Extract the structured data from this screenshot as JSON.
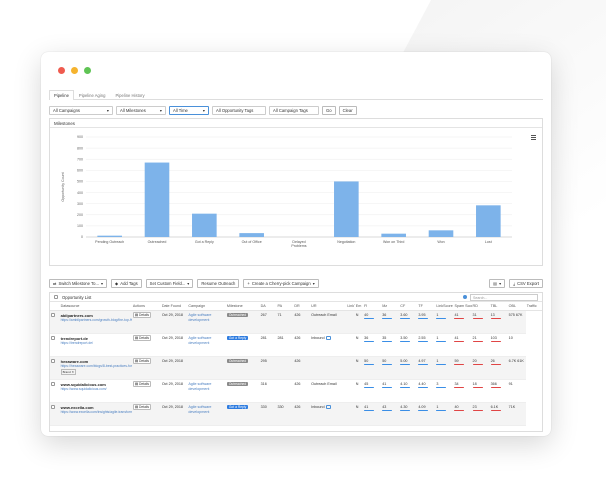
{
  "colors": {
    "dot_red": "#ef5b4f",
    "dot_yellow": "#f5b32e",
    "dot_green": "#5fc454",
    "bar": "#7db3ea",
    "accent": "#4a90d9"
  },
  "tabs": [
    {
      "label": "Pipeline",
      "active": true
    },
    {
      "label": "Pipeline Aging",
      "active": false
    },
    {
      "label": "Pipeline History",
      "active": false
    }
  ],
  "filters": {
    "campaigns": "All Campaigns",
    "milestones": "All Milestones",
    "time": "All Time",
    "opportunity_tags": "All Opportunity Tags",
    "campaign_tags": "All Campaign Tags",
    "go": "Go",
    "clear": "Clear"
  },
  "panel_title": "Milestones",
  "chart_data": {
    "type": "bar",
    "title": "",
    "xlabel": "",
    "ylabel": "Opportunity Count",
    "ylim": [
      0,
      900
    ],
    "yticks": [
      0,
      100,
      200,
      300,
      400,
      500,
      600,
      700,
      800,
      900
    ],
    "categories": [
      "Pending Outreach",
      "Outreached",
      "Got a Reply",
      "Out of Office",
      "Delayed Problems",
      "Negotiation",
      "Won on Third",
      "Won",
      "Lost"
    ],
    "category_labels": [
      [
        "Pending Outreach"
      ],
      [
        "Outreached"
      ],
      [
        "Got a Reply"
      ],
      [
        "Out of Office"
      ],
      [
        "Delayed",
        "Problems"
      ],
      [
        "Negotiation"
      ],
      [
        "Won on Third"
      ],
      [
        "Won"
      ],
      [
        "Lost"
      ]
    ],
    "values": [
      12,
      670,
      210,
      35,
      0,
      500,
      30,
      60,
      285
    ]
  },
  "toolbar": {
    "switch_milestone": "Switch Milestone To...",
    "add_tags": "Add Tags",
    "set_custom_field": "Set Custom Field...",
    "resume_outreach": "Resume Outreach",
    "create_campaign": "Create a Cherry-pick Campaign",
    "csv_export": "CSV Export"
  },
  "list": {
    "title": "Opportunity List",
    "search_placeholder": "Search...",
    "columns": [
      "Datasource",
      "Actions",
      "Date Found",
      "Campaign",
      "Milestone",
      "DA",
      "PA",
      "DR",
      "UR",
      "LinkType",
      "Em",
      "Fl",
      "Mz",
      "CF",
      "TF",
      "LinkScore",
      "Spam Score",
      "RD",
      "TBL",
      "OBL",
      "Traffic"
    ],
    "rows": [
      {
        "domain": "abilpartners.com",
        "url": "https://ambilpartners.com/growth-blog/the-top-five-agile-t...",
        "action": "Details",
        "date": "Oct 29, 2018",
        "campaign": "Agile software development",
        "status": "Outreached",
        "status_type": "out",
        "da": "267",
        "pa": "71",
        "dr": "426",
        "contact": "Outreach Email",
        "mail": false,
        "flag": "N",
        "m1": "40",
        "m2": "36",
        "m3": "3.60",
        "m4": "3.95",
        "spam": "1",
        "r1": "41",
        "r2": "31",
        "r3": "13",
        "traffic": "575",
        "traffic2": "67K",
        "tag": ""
      },
      {
        "domain": "trendreport.de",
        "url": "https://trendreport.de/",
        "action": "Details",
        "date": "Oct 29, 2018",
        "campaign": "Agile software development",
        "status": "Got a Reply",
        "status_type": "reply",
        "da": "281",
        "pa": "281",
        "dr": "426",
        "contact": "Inbound",
        "mail": true,
        "flag": "N",
        "m1": "36",
        "m2": "35",
        "m3": "3.50",
        "m4": "2.55",
        "spam": "1",
        "r1": "41",
        "r2": "21",
        "r3": "103",
        "traffic": "10",
        "traffic2": "",
        "tag": ""
      },
      {
        "domain": "hexaware.com",
        "url": "https://hexaware.com/blogs/8-best-practices-for-agile-s...",
        "action": "Details",
        "date": "Oct 29, 2018",
        "campaign": "",
        "status": "Outreached",
        "status_type": "out",
        "da": "295",
        "pa": "",
        "dr": "426",
        "contact": "",
        "mail": false,
        "flag": "N",
        "m1": "50",
        "m2": "50",
        "m3": "5.00",
        "m4": "4.97",
        "spam": "1",
        "r1": "59",
        "r2": "20",
        "r3": "26",
        "traffic": "6.7K",
        "traffic2": "61K",
        "tag": "Brand"
      },
      {
        "domain": "www.squidalicious.com",
        "url": "https://www.squidalicious.com/",
        "action": "Details",
        "date": "Oct 29, 2018",
        "campaign": "Agile software development",
        "status": "Outreached",
        "status_type": "out",
        "da": "316",
        "pa": "",
        "dr": "426",
        "contact": "Outreach Email",
        "mail": false,
        "flag": "N",
        "m1": "45",
        "m2": "41",
        "m3": "4.10",
        "m4": "4.40",
        "spam": "3",
        "r1": "34",
        "r2": "18",
        "r3": "366",
        "traffic": "91",
        "traffic2": "",
        "tag": ""
      },
      {
        "domain": "www.excella.com",
        "url": "https://www.excella.com/insights/agile-transformation-t...",
        "action": "Details",
        "date": "Oct 29, 2018",
        "campaign": "Agile software development",
        "status": "Got a Reply",
        "status_type": "reply",
        "da": "330",
        "pa": "330",
        "dr": "426",
        "contact": "Inbound",
        "mail": true,
        "flag": "N",
        "m1": "41",
        "m2": "43",
        "m3": "4.30",
        "m4": "4.09",
        "spam": "1",
        "r1": "40",
        "r2": "23",
        "r3": "6.1K",
        "traffic": "71K",
        "traffic2": "",
        "tag": ""
      }
    ]
  }
}
